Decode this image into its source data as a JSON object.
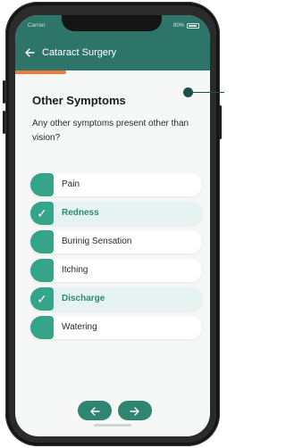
{
  "status_bar": {
    "carrier": "Carrier",
    "battery": "80%"
  },
  "header": {
    "back_icon": "arrow-left-icon",
    "title": "Cataract Surgery"
  },
  "progress": {
    "fraction": 0.26
  },
  "content": {
    "heading": "Other Symptoms",
    "question": "Any other symptoms present other than vision?"
  },
  "options": [
    {
      "label": "Pain",
      "selected": false
    },
    {
      "label": "Redness",
      "selected": true
    },
    {
      "label": "Burinig Sensation",
      "selected": false
    },
    {
      "label": "Itching",
      "selected": false
    },
    {
      "label": "Discharge",
      "selected": true
    },
    {
      "label": "Watering",
      "selected": false
    }
  ],
  "navigation": {
    "prev_icon": "arrow-left-icon",
    "next_icon": "arrow-right-icon"
  },
  "colors": {
    "header": "#2e7569",
    "accent": "#35a58a",
    "progress": "#f07a3c"
  }
}
